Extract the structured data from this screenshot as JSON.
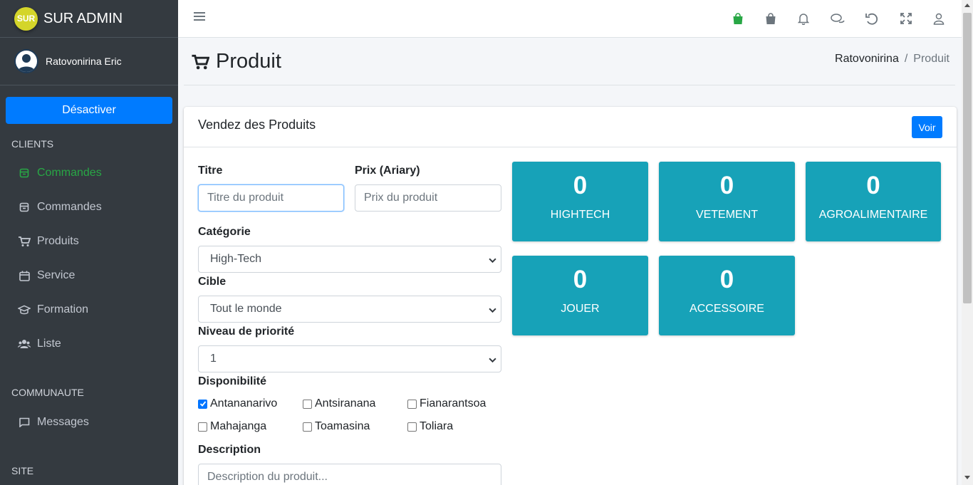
{
  "brand": {
    "logo_text": "SUR",
    "name": "SUR ADMIN"
  },
  "user": {
    "name": "Ratovonirina Eric"
  },
  "sidebar": {
    "deactivate_label": "Désactiver",
    "sections": [
      {
        "header": "CLIENTS"
      },
      {
        "header": "COMMUNAUTE"
      },
      {
        "header": "SITE"
      }
    ],
    "items": [
      {
        "label": "Commandes",
        "icon": "box-icon",
        "active": true
      },
      {
        "label": "Commandes",
        "icon": "box-icon"
      },
      {
        "label": "Produits",
        "icon": "cart-icon"
      },
      {
        "label": "Service",
        "icon": "calendar-icon"
      },
      {
        "label": "Formation",
        "icon": "graduation-cap-icon"
      },
      {
        "label": "Liste",
        "icon": "users-icon"
      },
      {
        "label": "Messages",
        "icon": "message-icon"
      }
    ]
  },
  "topbar": {
    "icons": [
      "shopping-bag-green-icon",
      "shopping-bag-icon",
      "bell-icon",
      "comments-icon",
      "undo-icon",
      "fullscreen-icon",
      "user-icon"
    ]
  },
  "page": {
    "title": "Produit",
    "breadcrumb": [
      "Ratovonirina",
      "/",
      "Produit"
    ]
  },
  "card": {
    "title": "Vendez des Produits",
    "view_button": "Voir"
  },
  "form": {
    "title_label": "Titre",
    "title_placeholder": "Titre du produit",
    "price_label": "Prix (Ariary)",
    "price_placeholder": "Prix du produit",
    "category_label": "Catégorie",
    "category_value": "High-Tech",
    "target_label": "Cible",
    "target_value": "Tout le monde",
    "priority_label": "Niveau de priorité",
    "priority_value": "1",
    "availability_label": "Disponibilité",
    "cities": [
      {
        "name": "Antananarivo",
        "checked": true
      },
      {
        "name": "Antsiranana",
        "checked": false
      },
      {
        "name": "Fianarantsoa",
        "checked": false
      },
      {
        "name": "Mahajanga",
        "checked": false
      },
      {
        "name": "Toamasina",
        "checked": false
      },
      {
        "name": "Toliara",
        "checked": false
      }
    ],
    "description_label": "Description",
    "description_placeholder": "Description du produit..."
  },
  "stats": [
    {
      "count": "0",
      "label": "HIGHTECH"
    },
    {
      "count": "0",
      "label": "VETEMENT"
    },
    {
      "count": "0",
      "label": "AGROALIMENTAIRE"
    },
    {
      "count": "0",
      "label": "JOUER"
    },
    {
      "count": "0",
      "label": "ACCESSOIRE"
    }
  ],
  "colors": {
    "sidebar": "#343a40",
    "primary": "#007bff",
    "info": "#17a2b8",
    "active": "#28a745"
  }
}
